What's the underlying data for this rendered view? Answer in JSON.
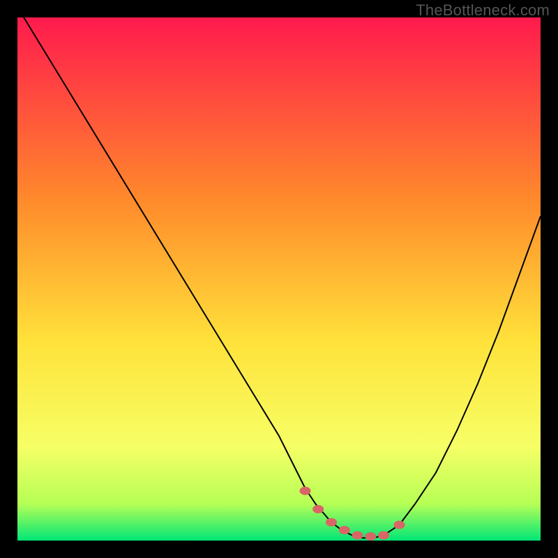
{
  "watermark": "TheBottleneck.com",
  "colors": {
    "gradient_top": "#ff1a4d",
    "gradient_mid1": "#ff8a2b",
    "gradient_mid2": "#ffe23a",
    "gradient_low": "#f6ff66",
    "gradient_bottom1": "#b6ff55",
    "gradient_bottom2": "#00e676",
    "curve": "#000000",
    "marker": "#d86666"
  },
  "chart_data": {
    "type": "line",
    "title": "",
    "xlabel": "",
    "ylabel": "",
    "xlim": [
      0,
      100
    ],
    "ylim": [
      0,
      100
    ],
    "grid": false,
    "series": [
      {
        "name": "bottleneck-curve",
        "x": [
          0,
          5,
          10,
          15,
          20,
          25,
          30,
          35,
          40,
          45,
          50,
          53,
          55,
          57,
          60,
          62,
          64,
          66,
          68,
          70,
          73,
          76,
          80,
          84,
          88,
          92,
          96,
          100
        ],
        "y": [
          102,
          93.8,
          85.6,
          77.4,
          69.2,
          61,
          52.8,
          44.6,
          36.4,
          28.2,
          20,
          14,
          10,
          7,
          3.5,
          2,
          1,
          0.5,
          0.5,
          1,
          3,
          7,
          13,
          21,
          30,
          40,
          51,
          62
        ]
      }
    ],
    "markers": {
      "name": "highlight-dots",
      "x": [
        55,
        57.5,
        60,
        62.5,
        65,
        67.5,
        70,
        73
      ],
      "y": [
        9.5,
        6,
        3.5,
        2,
        1,
        0.8,
        1,
        3
      ]
    }
  }
}
